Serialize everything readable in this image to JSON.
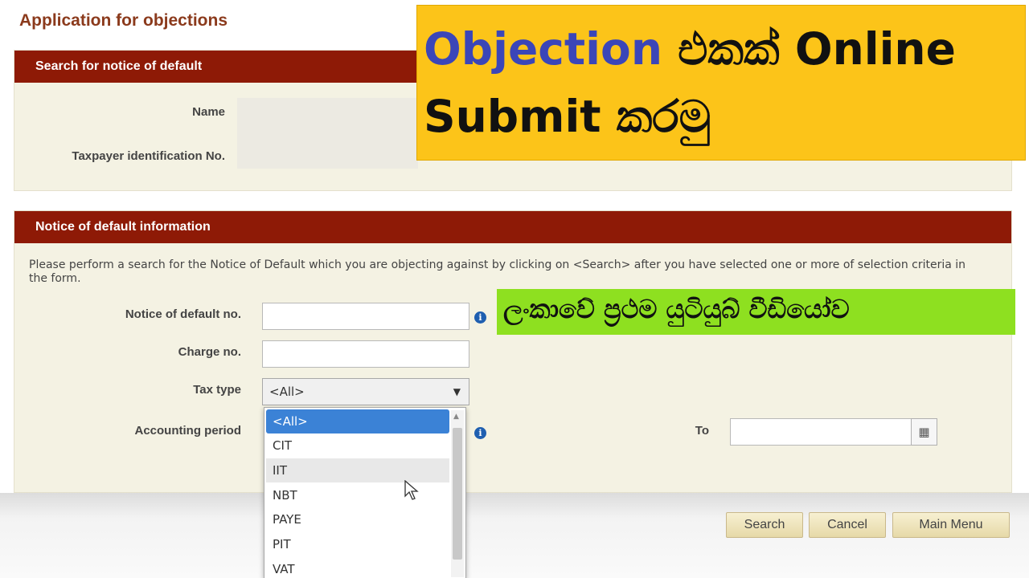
{
  "page": {
    "title": "Application for objections"
  },
  "search_panel": {
    "header": "Search for notice of default",
    "name_label": "Name",
    "tin_label": "Taxpayer identification No."
  },
  "notice_panel": {
    "header": "Notice of default information",
    "description": "Please perform a search for the Notice of Default which you are objecting against by clicking on <Search> after you have selected one or more of selection criteria in the form.",
    "notice_no_label": "Notice of default no.",
    "notice_no_value": "",
    "charge_no_label": "Charge no.",
    "charge_no_value": "",
    "tax_type_label": "Tax type",
    "tax_type_selected": "<All>",
    "accounting_period_label": "Accounting period",
    "to_label": "To",
    "to_value": ""
  },
  "tax_type_options": [
    "<All>",
    "CIT",
    "IIT",
    "NBT",
    "PAYE",
    "PIT",
    "VAT"
  ],
  "buttons": {
    "search": "Search",
    "cancel": "Cancel",
    "main_menu": "Main Menu"
  },
  "overlay": {
    "line1_highlight": "Objection",
    "line1_rest": " එකක් Online",
    "line2": "Submit කරමු",
    "tagline": "ලංකාවේ ප්‍රථම යුටියුබ් වීඩියෝව"
  },
  "colors": {
    "header_bg": "#8e1a06",
    "panel_bg": "#f4f2e3",
    "yellow_banner": "#fcc419",
    "green_banner": "#8ee020",
    "highlight_text": "#3b46b8",
    "selected_option": "#3b82d6"
  }
}
